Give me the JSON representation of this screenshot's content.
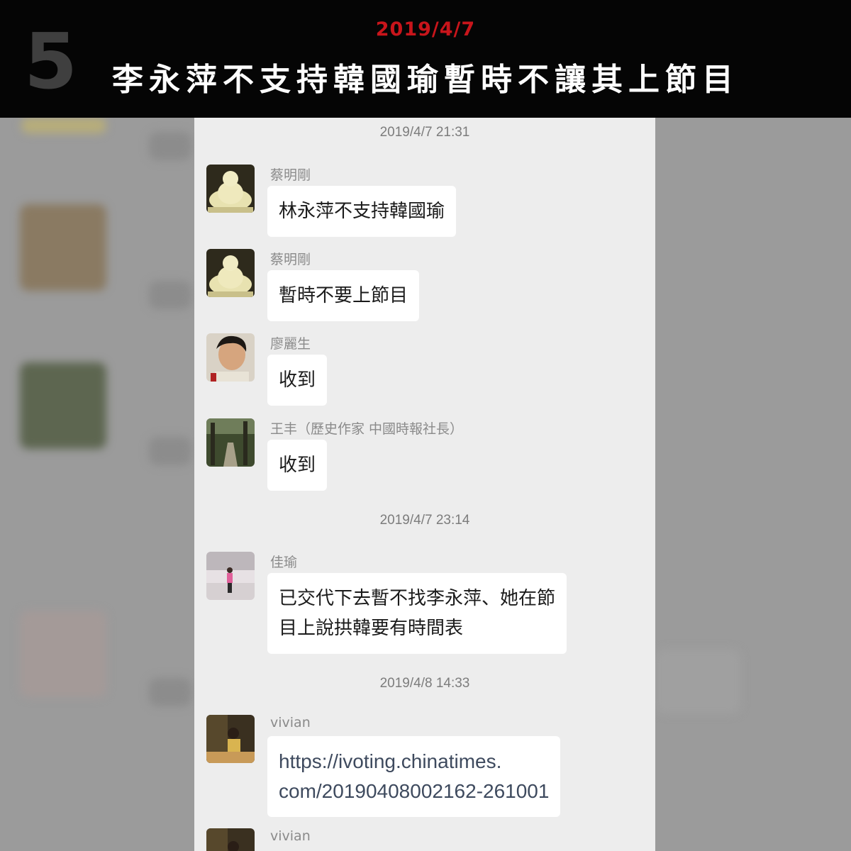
{
  "header": {
    "number": "5",
    "date": "2019/4/7",
    "headline": "李永萍不支持韓國瑜暫時不讓其上節目"
  },
  "chat": {
    "timestamps": [
      "2019/4/7 21:31",
      "2019/4/7 23:14",
      "2019/4/8 14:33"
    ],
    "messages": [
      {
        "sender": "蔡明剛",
        "avatar": "buddha-statue-avatar",
        "text": "林永萍不支持韓國瑜"
      },
      {
        "sender": "蔡明剛",
        "avatar": "buddha-statue-avatar",
        "text": "暫時不要上節目"
      },
      {
        "sender": "廖麗生",
        "avatar": "person-photo-avatar",
        "text": "收到"
      },
      {
        "sender": "王丰（歷史作家 中國時報社長）",
        "avatar": "forest-path-avatar",
        "text": "收到"
      },
      {
        "sender": "佳瑜",
        "avatar": "person-standing-avatar",
        "text_line1": "已交代下去暫不找李永萍、她在節",
        "text_line2": "目上說拱韓要有時間表"
      },
      {
        "sender": "vivian",
        "avatar": "woman-desk-avatar",
        "text_line1": "https://ivoting.chinatimes.",
        "text_line2": "com/20190408002162-261001"
      },
      {
        "sender": "vivian",
        "avatar": "woman-desk-avatar"
      }
    ]
  },
  "colors": {
    "header_bg": "#050505",
    "date_red": "#c8151b",
    "chat_bg": "#ededed",
    "bubble_bg": "#ffffff"
  }
}
